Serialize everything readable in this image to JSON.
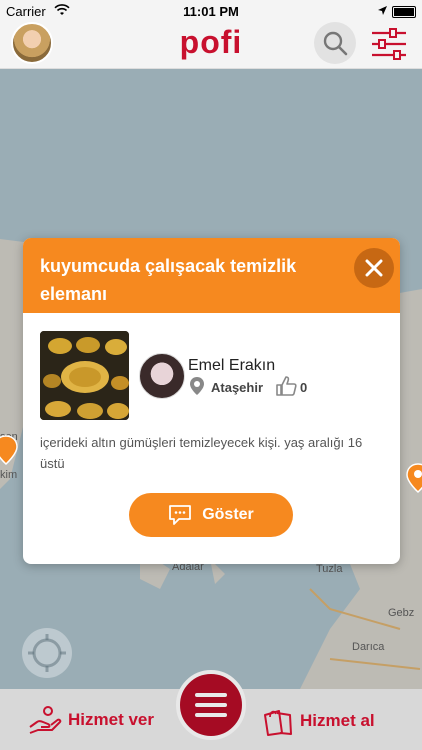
{
  "status": {
    "carrier": "Carrier",
    "time": "11:01 PM"
  },
  "header": {
    "logo": "pofi"
  },
  "map": {
    "labels": [
      "Adalar",
      "Tuzla",
      "Gebz",
      "Darıca",
      "kim",
      "sen"
    ]
  },
  "modal": {
    "title": "kuyumcuda çalışacak temizlik elemanı",
    "user_name": "Emel Erakın",
    "location": "Ataşehir",
    "likes": "0",
    "description": "içerideki altın gümüşleri temizleyecek kişi. yaş aralığı 16 üstü",
    "show_button": "Göster"
  },
  "bottom": {
    "provide_label": "Hizmet ver",
    "receive_label": "Hizmet al"
  },
  "colors": {
    "brand": "#c8102e",
    "accent": "#f6891f"
  }
}
